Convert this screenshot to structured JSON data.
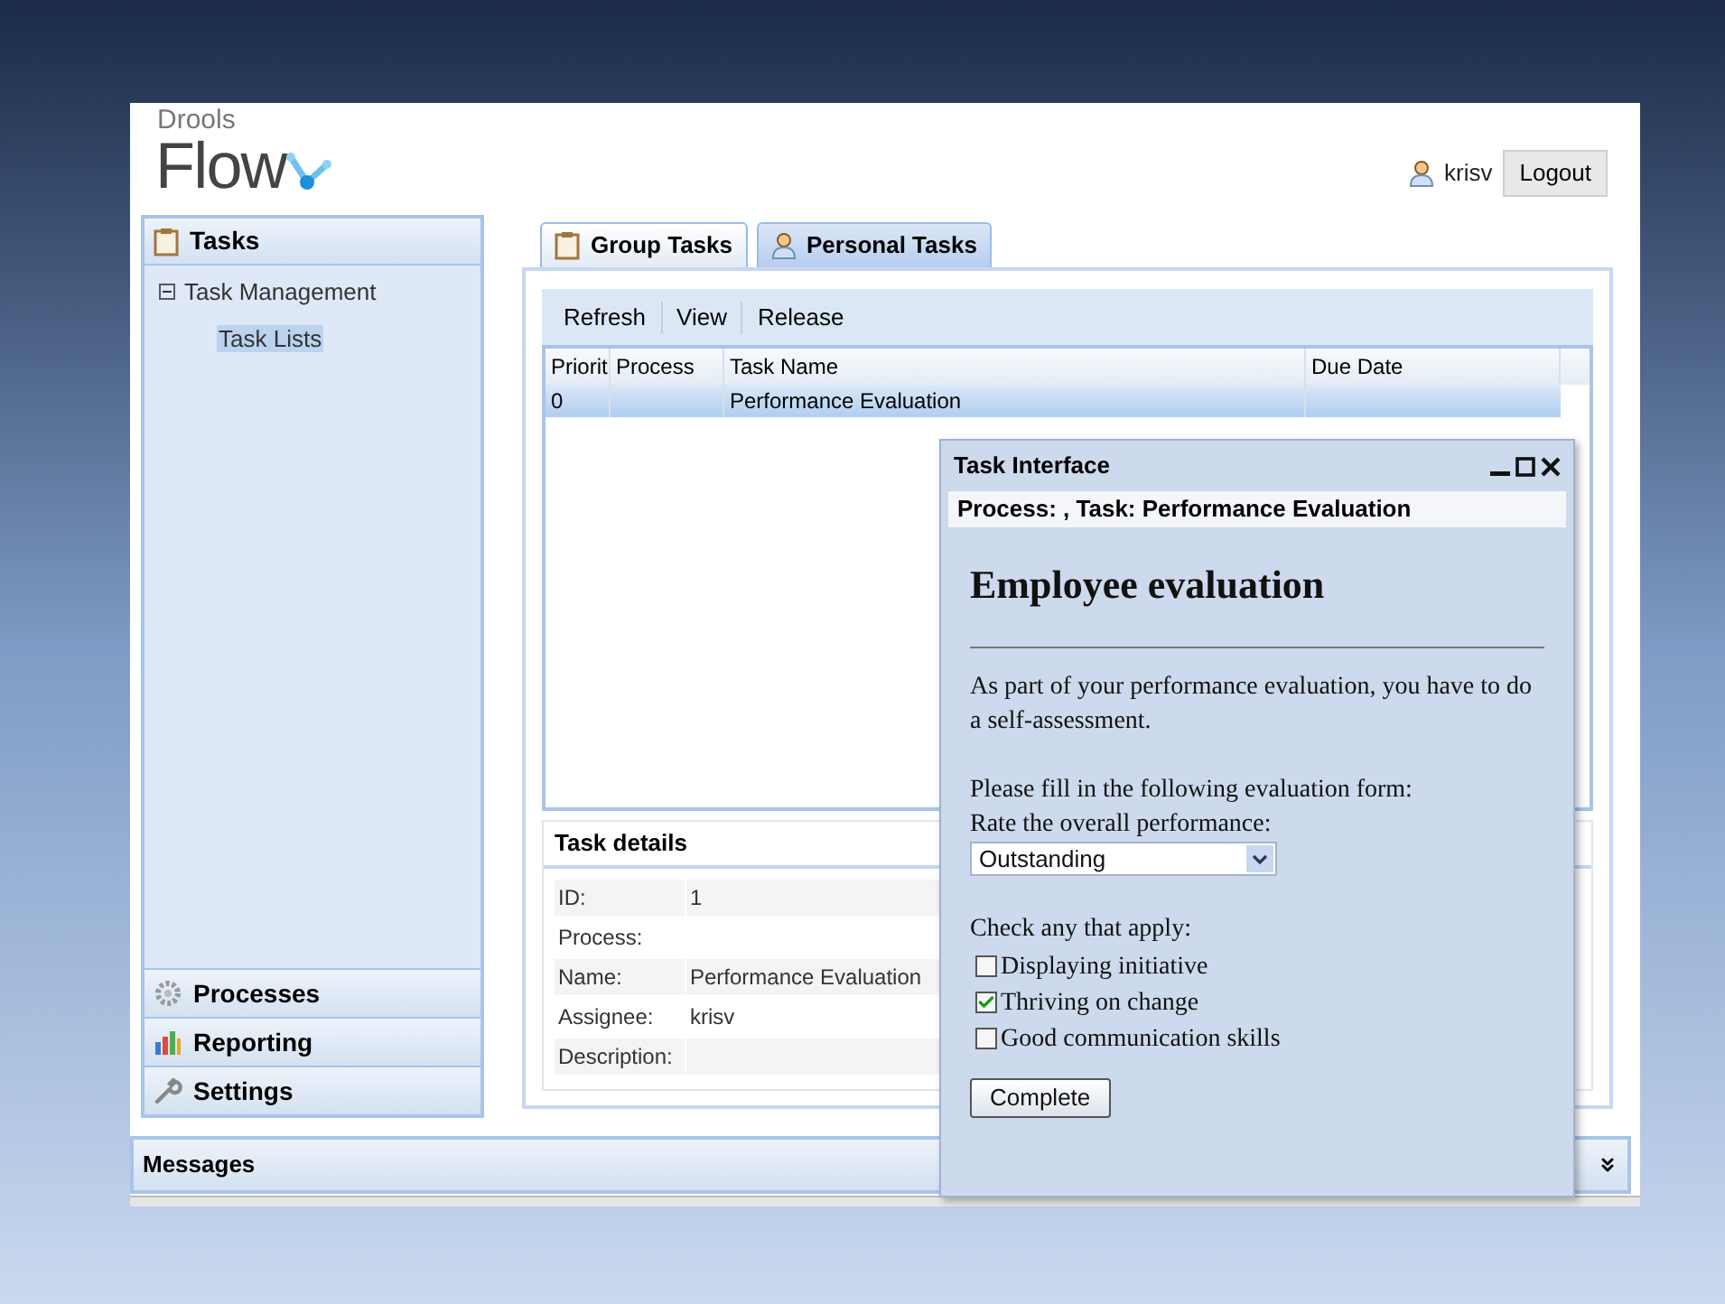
{
  "header": {
    "logo_small": "Drools",
    "logo_large": "Flow",
    "user": "krisv",
    "logout": "Logout"
  },
  "sidebar": {
    "sections": [
      {
        "label": "Tasks",
        "kind": "clipboard",
        "expanded": true,
        "tree": [
          {
            "label": "Task Management",
            "expanded": true,
            "children": [
              {
                "label": "Task Lists",
                "selected": true
              }
            ]
          }
        ]
      },
      {
        "label": "Processes",
        "kind": "gear",
        "expanded": false
      },
      {
        "label": "Reporting",
        "kind": "chart",
        "expanded": false
      },
      {
        "label": "Settings",
        "kind": "wrench",
        "expanded": false
      }
    ]
  },
  "tabs": [
    {
      "label": "Group Tasks",
      "kind": "clipboard",
      "selected": false
    },
    {
      "label": "Personal Tasks",
      "kind": "person",
      "selected": true
    }
  ],
  "toolbar": [
    "Refresh",
    "View",
    "Release"
  ],
  "table": {
    "columns": [
      "Priorit",
      "Process",
      "Task Name",
      "Due Date"
    ],
    "rows": [
      {
        "priority": "0",
        "task_name": "Performance Evaluation",
        "selected": true
      }
    ]
  },
  "task_details": {
    "title": "Task details",
    "fields": [
      {
        "label": "ID:",
        "value": "1"
      },
      {
        "label": "Process:"
      },
      {
        "label": "Name:",
        "value": "Performance Evaluation"
      },
      {
        "label": "Assignee:",
        "value": "krisv"
      },
      {
        "label": "Description:"
      }
    ]
  },
  "dialog": {
    "title": "Task Interface",
    "subtitle": "Process: , Task: Performance Evaluation",
    "heading": "Employee evaluation",
    "intro": "As part of your performance evaluation, you have to do a self-assessment.",
    "form_prompt": "Please fill in the following evaluation form:",
    "rating_label": "Rate the overall performance:",
    "rating_value": "Outstanding",
    "checks_label": "Check any that apply:",
    "checks": [
      {
        "label": "Displaying initiative",
        "checked": false
      },
      {
        "label": "Thriving on change",
        "checked": true
      },
      {
        "label": "Good communication skills",
        "checked": false
      }
    ],
    "submit": "Complete"
  },
  "messages": {
    "title": "Messages",
    "expanded": false
  }
}
